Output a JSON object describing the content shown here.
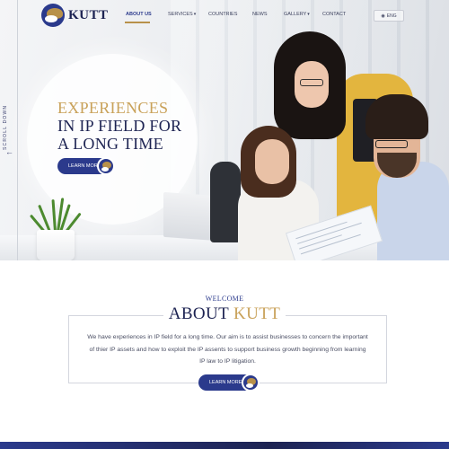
{
  "brand": {
    "name": "KUTT",
    "colors": {
      "navy": "#1d2352",
      "blue": "#2b3a8c",
      "gold": "#c9a25a"
    }
  },
  "nav": {
    "items": [
      {
        "label": "ABOUT US",
        "active": true,
        "dropdown": false
      },
      {
        "label": "SERVICES",
        "active": false,
        "dropdown": true
      },
      {
        "label": "COUNTRIES",
        "active": false,
        "dropdown": false
      },
      {
        "label": "NEWS",
        "active": false,
        "dropdown": false
      },
      {
        "label": "GALLERY",
        "active": false,
        "dropdown": true
      },
      {
        "label": "CONTACT",
        "active": false,
        "dropdown": false
      }
    ],
    "language": "ENG"
  },
  "sidebar": {
    "scroll_label": "SCROLL DOWN"
  },
  "hero": {
    "line1": "EXPERIENCES",
    "line2": "IN IP FIELD FOR",
    "line3": "A LONG TIME",
    "button_label": "LEARN MORE"
  },
  "about": {
    "kicker": "WELCOME",
    "title_part1": "ABOUT ",
    "title_part2": "KUTT",
    "text": "We have experiences in IP field for a long time. Our aim is to assist businesses to concern the important of thier IP assets and how to exploit the IP assents to support business growth beginning from learning IP law to IP litigation.",
    "button_label": "LEARN MORE"
  },
  "icons": [
    "logo-icon",
    "globe-icon",
    "chevron-down-icon",
    "arrow-left-icon"
  ]
}
